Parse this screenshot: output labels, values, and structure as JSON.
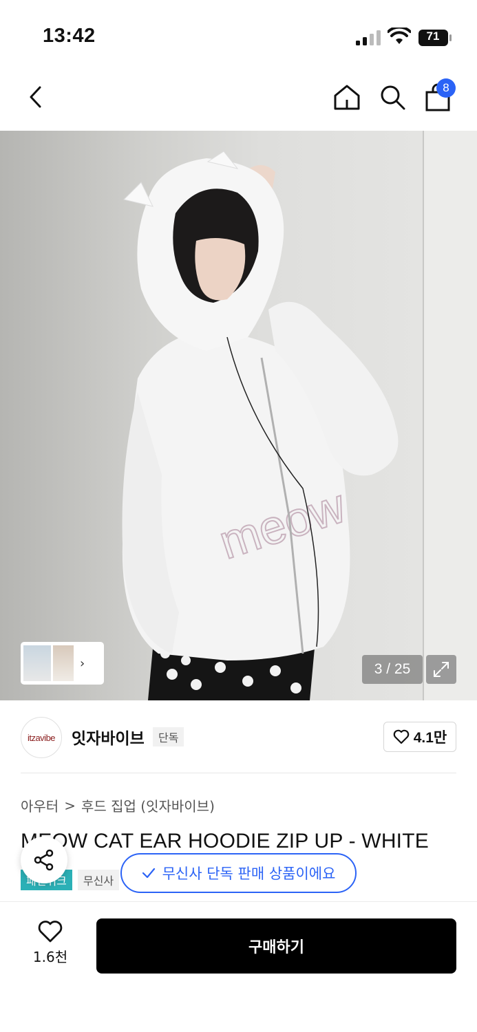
{
  "status_bar": {
    "time": "13:42",
    "battery": "71"
  },
  "header": {
    "back_icon": "chevron-left-icon",
    "home_icon": "home-icon",
    "search_icon": "search-icon",
    "cart_icon": "shopping-bag-icon",
    "cart_count": "8"
  },
  "gallery": {
    "counter": "3 / 25",
    "expand_icon": "expand-icon"
  },
  "brand": {
    "logo_text": "itzavibe",
    "name": "잇자바이브",
    "tag": "단독",
    "likes": "4.1만"
  },
  "breadcrumb": {
    "level1": "아우터",
    "separator": ">",
    "level2": "후드 집업 (잇자바이브)"
  },
  "product": {
    "title": "MEOW CAT EAR HOODIE ZIP UP - WHITE",
    "tags": [
      "패션위크",
      "무신사"
    ]
  },
  "toast": {
    "text": "무신사 단독 판매 상품이에요"
  },
  "bottom_bar": {
    "wish_count": "1.6천",
    "buy_label": "구매하기"
  },
  "colors": {
    "accent_blue": "#2b63f6",
    "tag_teal": "#2bb0b6",
    "buy_button": "#000000"
  }
}
